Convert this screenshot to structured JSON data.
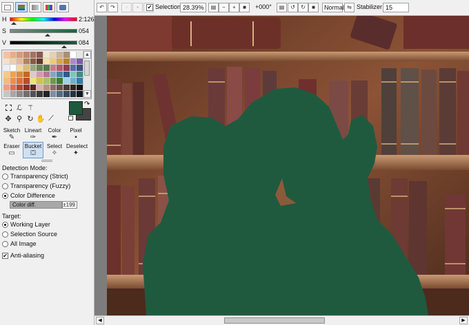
{
  "color_sliders": {
    "h": {
      "label": "H",
      "value": "2:126",
      "gradient": "linear-gradient(to right,#ff0000,#ffff00,#00ff00,#00ffff,#0000ff,#ff00ff,#ff0000)"
    },
    "s": {
      "label": "S",
      "value": "054",
      "gradient": "linear-gradient(to right,#7b8a84,#0c6a3a)"
    },
    "v": {
      "label": "V",
      "value": "084",
      "gradient": "linear-gradient(to right,#000000,#1f5a3f)"
    }
  },
  "current_color": "#1f5a3f",
  "swatches": [
    "#f3c2a0",
    "#e8ad87",
    "#d89a79",
    "#c28770",
    "#a87062",
    "#8a5a4f",
    "#f0e4d2",
    "#e5d1b8",
    "#c9b39a",
    "#a89077",
    "#ffffff",
    "#e6e6e6",
    "#f6e0c8",
    "#f0cfb0",
    "#e4b897",
    "#b9805f",
    "#8f5642",
    "#5e3a2c",
    "#f7e0a5",
    "#f1cc6e",
    "#d8a747",
    "#b7822d",
    "#a78ac9",
    "#7c5da6",
    "#e8f0f7",
    "#ffffff",
    "#f2d6a2",
    "#d9bb7a",
    "#98a97a",
    "#6c8457",
    "#55784d",
    "#c97c86",
    "#b35c6c",
    "#8e3e52",
    "#5a6aa5",
    "#3d4c84",
    "#f4c98e",
    "#eaa44f",
    "#d98c3b",
    "#c5681f",
    "#e6c6d0",
    "#d19bb1",
    "#b8778f",
    "#7fa7c9",
    "#4f7fa8",
    "#2f5c86",
    "#7ec7b9",
    "#3b8f81",
    "#f5b884",
    "#ec8f4d",
    "#e26f37",
    "#b84e29",
    "#f2e36c",
    "#d8c33a",
    "#a8c06b",
    "#6d9b45",
    "#3f7a36",
    "#a1d1e6",
    "#6bb1d1",
    "#2e7fae",
    "#f09e7a",
    "#dd6d4e",
    "#bb4433",
    "#8b2f27",
    "#5d2320",
    "#d7b3a4",
    "#b88f82",
    "#8b6c64",
    "#6a504a",
    "#4a3834",
    "#2f2422",
    "#141010",
    "#c6c6c6",
    "#a7a7a7",
    "#8a8a8a",
    "#6e6e6e",
    "#525252",
    "#393939",
    "#222222",
    "#7b90a6",
    "#566b82",
    "#3b4b5e",
    "#263140",
    "#111820"
  ],
  "tools": {
    "row1": [
      {
        "label": "Sketch",
        "icon": "✎"
      },
      {
        "label": "Lineart",
        "icon": "✑"
      },
      {
        "label": "Color",
        "icon": "✒"
      },
      {
        "label": "Pixel",
        "icon": "▪"
      }
    ],
    "row2": [
      {
        "label": "Eraser",
        "icon": "▭"
      },
      {
        "label": "Bucket",
        "icon": "⛋"
      },
      {
        "label": "Select",
        "icon": "✧"
      },
      {
        "label": "Deselect",
        "icon": "✦"
      }
    ]
  },
  "detection": {
    "heading": "Detection Mode:",
    "options": [
      "Transparency (Strict)",
      "Transparency (Fuzzy)",
      "Color Difference"
    ],
    "color_diff_label": "Color diff.",
    "color_diff_value": "±199"
  },
  "target": {
    "heading": "Target:",
    "options": [
      "Working Layer",
      "Selection Source",
      "All Image"
    ]
  },
  "antialias_label": "Anti-aliasing",
  "toolbar": {
    "selection_label": "Selection",
    "zoom": "28.39%",
    "rotation": "+000°",
    "blend_mode": "Normal",
    "stabilizer_label": "Stabilizer",
    "stabilizer_value": "15"
  },
  "canvas": {
    "fill_color": "#1f5a3f"
  }
}
